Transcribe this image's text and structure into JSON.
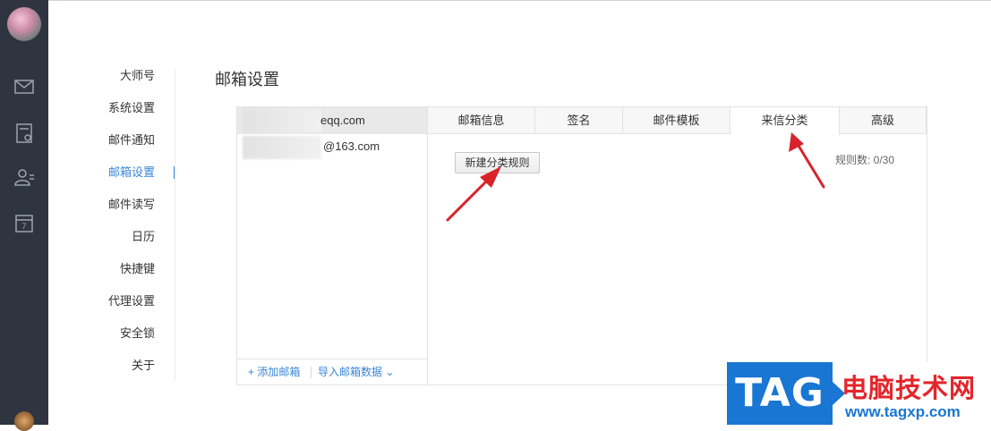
{
  "sidebar_icons": [
    "avatar",
    "mail-icon",
    "notes-icon",
    "contacts-icon",
    "calendar-icon"
  ],
  "calendar_day": "7",
  "settings_nav": {
    "items": [
      {
        "label": "大师号"
      },
      {
        "label": "系统设置"
      },
      {
        "label": "邮件通知"
      },
      {
        "label": "邮箱设置",
        "active": true
      },
      {
        "label": "邮件读写"
      },
      {
        "label": "日历"
      },
      {
        "label": "快捷键"
      },
      {
        "label": "代理设置"
      },
      {
        "label": "安全锁"
      },
      {
        "label": "关于"
      }
    ]
  },
  "page": {
    "title": "邮箱设置"
  },
  "accounts": {
    "items": [
      {
        "email": "eqq.com",
        "selected": true
      },
      {
        "email": "@163.com",
        "selected": false
      }
    ],
    "add_label": "+ 添加邮箱",
    "import_label": "导入邮箱数据 ⌄"
  },
  "tabs": [
    {
      "label": "邮箱信息"
    },
    {
      "label": "签名"
    },
    {
      "label": "邮件模板"
    },
    {
      "label": "来信分类",
      "active": true
    },
    {
      "label": "高级"
    }
  ],
  "rules": {
    "new_rule_label": "新建分类规则",
    "count_label": "规则数: 0/30"
  },
  "annotation_color": "#d9232a",
  "watermark": {
    "tag": "TAG",
    "site_name": "电脑技术网",
    "url": "www.tagxp.com"
  }
}
